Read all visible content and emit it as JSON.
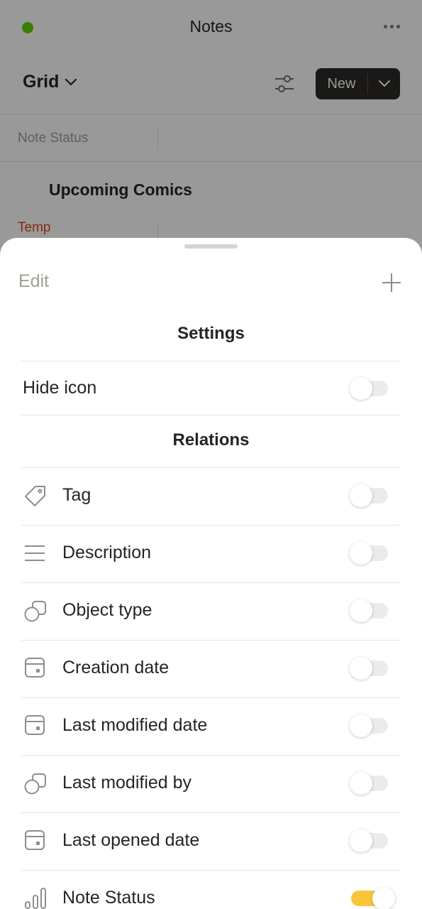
{
  "header": {
    "title": "Notes"
  },
  "toolbar": {
    "view_label": "Grid",
    "new_label": "New"
  },
  "list": {
    "column_header": "Note Status",
    "group_title": "Upcoming Comics",
    "status_value": "Temp"
  },
  "sheet": {
    "edit_label": "Edit",
    "settings_title": "Settings",
    "relations_title": "Relations",
    "settings": [
      {
        "label": "Hide icon",
        "on": false
      }
    ],
    "relations": [
      {
        "label": "Tag",
        "icon": "tag-icon",
        "on": false
      },
      {
        "label": "Description",
        "icon": "description-icon",
        "on": false
      },
      {
        "label": "Object type",
        "icon": "object-type-icon",
        "on": false
      },
      {
        "label": "Creation date",
        "icon": "calendar-icon",
        "on": false
      },
      {
        "label": "Last modified date",
        "icon": "calendar-icon",
        "on": false
      },
      {
        "label": "Last modified by",
        "icon": "object-type-icon",
        "on": false
      },
      {
        "label": "Last opened date",
        "icon": "calendar-icon",
        "on": false
      },
      {
        "label": "Note Status",
        "icon": "status-icon",
        "on": true
      }
    ]
  },
  "colors": {
    "accent": "#f6c638",
    "status_dot": "#5dd400",
    "temp": "#e0481a"
  }
}
